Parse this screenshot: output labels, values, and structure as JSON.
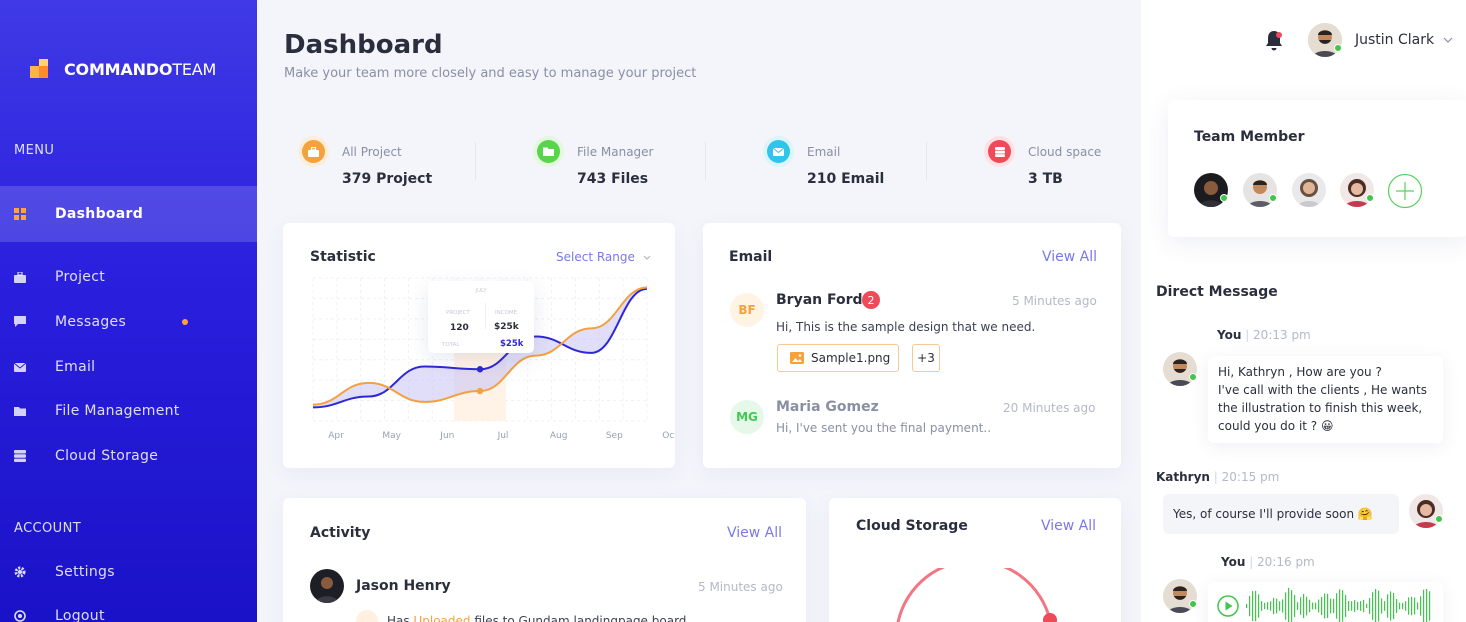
{
  "app": {
    "brand_bold": "COMMANDO",
    "brand_light": "TEAM"
  },
  "sidebar": {
    "menu_title": "MENU",
    "account_title": "ACCOUNT",
    "items": [
      {
        "label": "Dashboard",
        "icon": "grid-icon",
        "active": true
      },
      {
        "label": "Project",
        "icon": "briefcase-icon"
      },
      {
        "label": "Messages",
        "icon": "chat-icon",
        "notify": true
      },
      {
        "label": "Email",
        "icon": "mail-icon"
      },
      {
        "label": "File Management",
        "icon": "folder-icon"
      },
      {
        "label": "Cloud Storage",
        "icon": "storage-icon"
      }
    ],
    "account_items": [
      {
        "label": "Settings",
        "icon": "gear-icon"
      },
      {
        "label": "Logout",
        "icon": "logout-icon"
      }
    ]
  },
  "header": {
    "title": "Dashboard",
    "subtitle": "Make your team more closely and easy to manage your project"
  },
  "stats": [
    {
      "label": "All Project",
      "value": "379 Project",
      "color": "#f6a23a",
      "icon": "briefcase-icon"
    },
    {
      "label": "File Manager",
      "value": "743 Files",
      "color": "#5ad44d",
      "icon": "folder-icon"
    },
    {
      "label": "Email",
      "value": "210 Email",
      "color": "#2fc5e9",
      "icon": "mail-icon"
    },
    {
      "label": "Cloud space",
      "value": "3 TB",
      "color": "#ef4a5a",
      "icon": "storage-icon"
    }
  ],
  "statistic": {
    "title": "Statistic",
    "range_label": "Select Range",
    "tooltip": {
      "month": "JULY",
      "project_label": "PROJECT",
      "project_value": "120",
      "income_label": "INCOME",
      "income_value": "$25k",
      "total_label": "TOTAL",
      "total_value": "$25k"
    }
  },
  "chart_data": {
    "type": "line",
    "categories": [
      "Apr",
      "May",
      "Jun",
      "Jul",
      "Aug",
      "Sep",
      "Oct"
    ],
    "series": [
      {
        "color": "#2f27d6",
        "values": [
          10,
          18,
          40,
          38,
          62,
          50,
          97
        ]
      },
      {
        "color": "#f4a040",
        "values": [
          12,
          28,
          14,
          22,
          48,
          68,
          98
        ]
      }
    ],
    "highlight_category": "Jul",
    "ylim": [
      0,
      105
    ],
    "grid": true
  },
  "email": {
    "title": "Email",
    "view_all": "View All",
    "items": [
      {
        "initials": "BF",
        "name": "Bryan Ford",
        "badge": "2",
        "time": "5 Minutes ago",
        "preview": "Hi, This is the sample design that we need.",
        "attachment": "Sample1.png",
        "more": "+3",
        "color": "#f6a23a",
        "bg": "#fff3e3"
      },
      {
        "initials": "MG",
        "name": "Maria Gomez",
        "time": "20 Minutes ago",
        "preview": "Hi, I've sent you the final payment..",
        "color": "#45c759",
        "bg": "#e6f8e9"
      }
    ]
  },
  "activity": {
    "title": "Activity",
    "view_all": "View All",
    "items": [
      {
        "name": "Jason Henry",
        "time": "5 Minutes ago",
        "text_pre": "Has ",
        "text_link": "Uploaded",
        "text_post": " files to Gundam landingpage board"
      }
    ]
  },
  "cloud": {
    "title": "Cloud Storage",
    "view_all": "View All"
  },
  "user": {
    "name": "Justin Clark"
  },
  "team": {
    "title": "Team Member"
  },
  "dm": {
    "title": "Direct Message",
    "messages": [
      {
        "sender": "You",
        "time": "20:13 pm",
        "text": "Hi, Kathryn , How are you ?\nI've call with the clients , He wants the illustration to finish this week, could you do it ? 😀"
      },
      {
        "sender": "Kathryn",
        "time": "20:15 pm",
        "text": "Yes, of course I'll provide soon 🤗"
      },
      {
        "sender": "You",
        "time": "20:16 pm",
        "text": ""
      }
    ]
  }
}
